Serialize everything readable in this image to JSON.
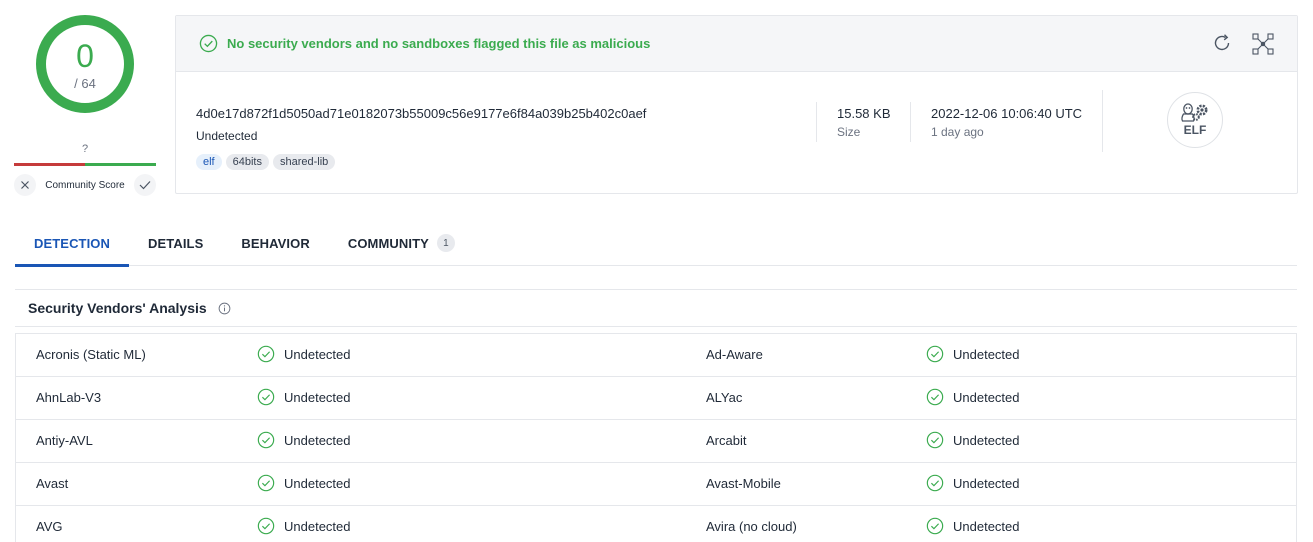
{
  "score": {
    "detections": "0",
    "total": "/ 64",
    "community_score_value": "?",
    "community_score_label": "Community Score"
  },
  "banner": {
    "message": "No security vendors and no sandboxes flagged this file as malicious"
  },
  "file": {
    "hash": "4d0e17d872f1d5050ad71e0182073b55009c56e9177e6f84a039b25b402c0aef",
    "status": "Undetected",
    "tags": [
      "elf",
      "64bits",
      "shared-lib"
    ],
    "size_value": "15.58 KB",
    "size_label": "Size",
    "date_value": "2022-12-06 10:06:40 UTC",
    "date_relative": "1 day ago",
    "type_badge": "ELF"
  },
  "tabs": [
    {
      "label": "DETECTION",
      "active": true
    },
    {
      "label": "DETAILS",
      "active": false
    },
    {
      "label": "BEHAVIOR",
      "active": false
    },
    {
      "label": "COMMUNITY",
      "active": false,
      "badge": "1"
    }
  ],
  "section": {
    "title": "Security Vendors' Analysis"
  },
  "vendors": [
    {
      "left": {
        "name": "Acronis (Static ML)",
        "result": "Undetected"
      },
      "right": {
        "name": "Ad-Aware",
        "result": "Undetected"
      }
    },
    {
      "left": {
        "name": "AhnLab-V3",
        "result": "Undetected"
      },
      "right": {
        "name": "ALYac",
        "result": "Undetected"
      }
    },
    {
      "left": {
        "name": "Antiy-AVL",
        "result": "Undetected"
      },
      "right": {
        "name": "Arcabit",
        "result": "Undetected"
      }
    },
    {
      "left": {
        "name": "Avast",
        "result": "Undetected"
      },
      "right": {
        "name": "Avast-Mobile",
        "result": "Undetected"
      }
    },
    {
      "left": {
        "name": "AVG",
        "result": "Undetected"
      },
      "right": {
        "name": "Avira (no cloud)",
        "result": "Undetected"
      }
    }
  ],
  "colors": {
    "clean_green": "#3bab4f",
    "malicious_red": "#c53b3b",
    "accent_blue": "#1a56b5"
  }
}
